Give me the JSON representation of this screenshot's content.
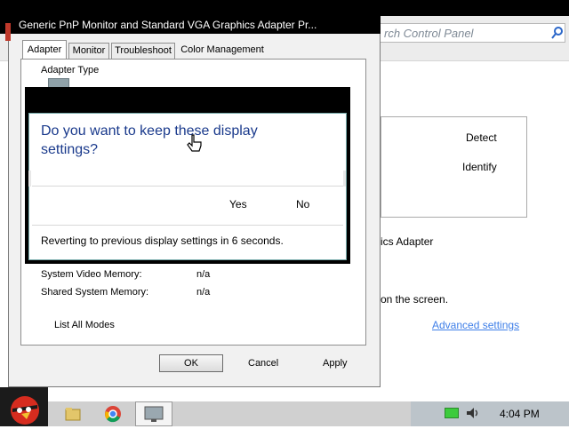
{
  "dialog": {
    "title": "Generic PnP Monitor and Standard VGA Graphics Adapter Pr...",
    "tabs": [
      "Adapter",
      "Monitor",
      "Troubleshoot",
      "Color Management"
    ],
    "adapter_type_label": "Adapter Type",
    "rows": [
      {
        "label": "System Video Memory:",
        "value": "n/a"
      },
      {
        "label": "Shared System Memory:",
        "value": "n/a"
      }
    ],
    "list_all_modes": "List All Modes",
    "ok": "OK",
    "cancel": "Cancel",
    "apply": "Apply"
  },
  "keep_dialog": {
    "question": "Do you want to keep these display settings?",
    "yes": "Yes",
    "no": "No",
    "revert_text": "Reverting to previous display settings in 6 seconds."
  },
  "control_panel": {
    "search_placeholder": "rch Control Panel",
    "detect": "Detect",
    "identify": "Identify",
    "adapter_text": "ics Adapter",
    "onscreen_text": "on the screen.",
    "advanced_settings": "Advanced settings"
  },
  "taskbar": {
    "clock": "4:04 PM",
    "icons": [
      "angry-bird-start-icon",
      "folder-icon",
      "chrome-icon",
      "display-settings-icon",
      "battery-icon",
      "volume-icon"
    ]
  },
  "colors": {
    "accent_link": "#3f7fe8",
    "question_text": "#1a3a8c"
  }
}
